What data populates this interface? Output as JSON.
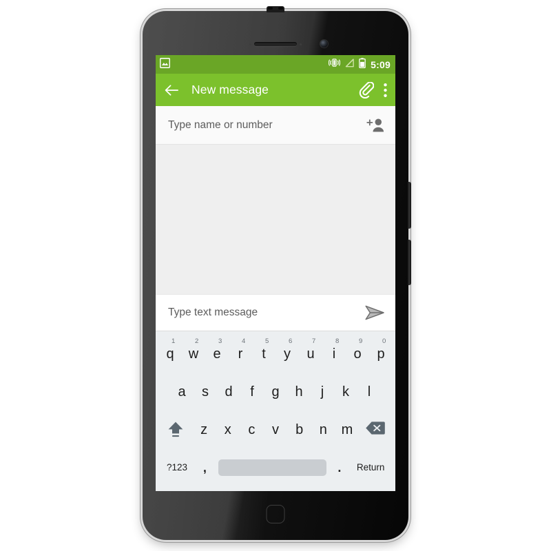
{
  "device": {
    "name": "android-smartphone",
    "hardware": {
      "earpiece": "earpiece-speaker",
      "front_camera": "front-camera",
      "home_button": "home-button",
      "volume_button": "volume-rocker",
      "power_button": "power-button",
      "antenna": "antenna-nub"
    }
  },
  "colors": {
    "status_bar": "#6aa626",
    "app_bar": "#7cc12c",
    "accent_green": "#7cc12c",
    "screen_bg": "#efefef",
    "keyboard_bg": "#eceff1",
    "spacebar": "#c9cdd1",
    "key_text": "#1d1d1d",
    "hint_text": "#6c7278",
    "placeholder_text": "#5c5c5c",
    "shift_key": "#5b6770",
    "backspace_key": "#5b6770"
  },
  "status_bar": {
    "notification_icons": [
      {
        "name": "image-notification-icon",
        "label": "Image"
      }
    ],
    "system_icons": [
      {
        "name": "vibrate-icon",
        "label": "Vibrate mode"
      },
      {
        "name": "signal-off-icon",
        "label": "No signal"
      },
      {
        "name": "battery-icon",
        "label": "Battery"
      }
    ],
    "time": "5:09"
  },
  "app_bar": {
    "back_label": "Back",
    "back_icon": "arrow-back-icon",
    "title": "New message",
    "actions": [
      {
        "name": "attach-icon",
        "label": "Attach"
      },
      {
        "name": "overflow-menu-icon",
        "label": "More options"
      }
    ]
  },
  "recipient": {
    "placeholder": "Type name or number",
    "value": "",
    "add_contact_icon": "add-person-icon",
    "add_contact_label": "Add recipient"
  },
  "conversation": {
    "messages": [],
    "empty": true
  },
  "compose": {
    "placeholder": "Type text message",
    "value": "",
    "send_icon": "send-icon",
    "send_label": "Send"
  },
  "keyboard": {
    "layout": "qwerty",
    "rows": [
      {
        "name": "row-1",
        "keys": [
          {
            "letter": "q",
            "num": "1"
          },
          {
            "letter": "w",
            "num": "2"
          },
          {
            "letter": "e",
            "num": "3"
          },
          {
            "letter": "r",
            "num": "4"
          },
          {
            "letter": "t",
            "num": "5"
          },
          {
            "letter": "y",
            "num": "6"
          },
          {
            "letter": "u",
            "num": "7"
          },
          {
            "letter": "i",
            "num": "8"
          },
          {
            "letter": "o",
            "num": "9"
          },
          {
            "letter": "p",
            "num": "0"
          }
        ]
      },
      {
        "name": "row-2",
        "keys": [
          {
            "letter": "a"
          },
          {
            "letter": "s"
          },
          {
            "letter": "d"
          },
          {
            "letter": "f"
          },
          {
            "letter": "g"
          },
          {
            "letter": "h"
          },
          {
            "letter": "j"
          },
          {
            "letter": "k"
          },
          {
            "letter": "l"
          }
        ]
      },
      {
        "name": "row-3",
        "shift_label": "Shift",
        "shift_icon": "shift-icon",
        "keys": [
          {
            "letter": "z"
          },
          {
            "letter": "x"
          },
          {
            "letter": "c"
          },
          {
            "letter": "v"
          },
          {
            "letter": "b"
          },
          {
            "letter": "n"
          },
          {
            "letter": "m"
          }
        ],
        "backspace_label": "Backspace",
        "backspace_icon": "backspace-icon"
      },
      {
        "name": "row-4",
        "symbols_label": "?123",
        "comma_label": ",",
        "space_label": "",
        "period_label": ".",
        "return_label": "Return"
      }
    ]
  }
}
